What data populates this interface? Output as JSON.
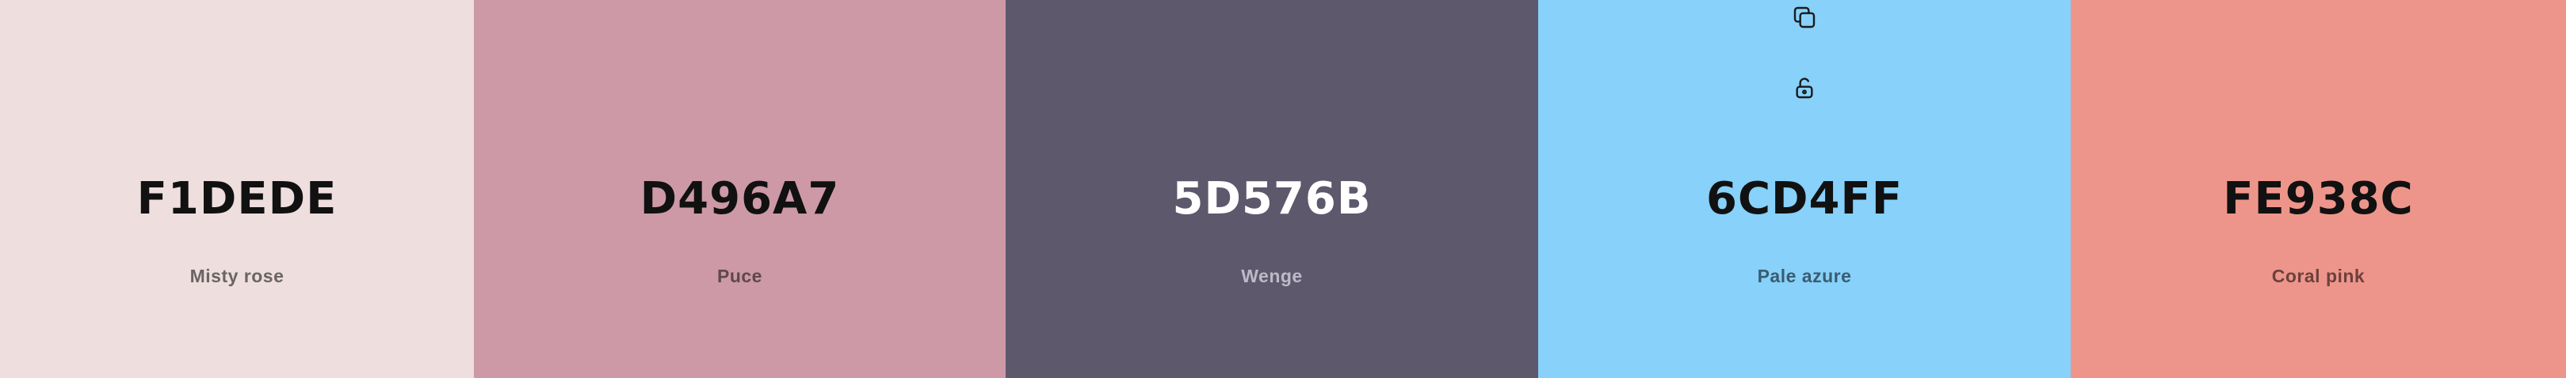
{
  "palette": {
    "swatches": [
      {
        "hex": "F1DEDE",
        "name": "Misty rose",
        "bg": "#EEDEDE",
        "text_color": "#111111",
        "name_color": "#6B6464"
      },
      {
        "hex": "D496A7",
        "name": "Puce",
        "bg": "#CD99A7",
        "text_color": "#111111",
        "name_color": "#5F474E"
      },
      {
        "hex": "5D576B",
        "name": "Wenge",
        "bg": "#5D586C",
        "text_color": "#FFFFFF",
        "name_color": "#BDB9C7"
      },
      {
        "hex": "6CD4FF",
        "name": "Pale azure",
        "bg": "#87D1FA",
        "text_color": "#111111",
        "name_color": "#3A5C70"
      },
      {
        "hex": "FE938C",
        "name": "Coral pink",
        "bg": "#EE958B",
        "text_color": "#111111",
        "name_color": "#6B413C"
      }
    ],
    "hovered_swatch_tools": [
      {
        "icon": "copy-icon"
      },
      {
        "icon": "unlock-icon"
      }
    ],
    "hovered_swatch_index": 3
  }
}
